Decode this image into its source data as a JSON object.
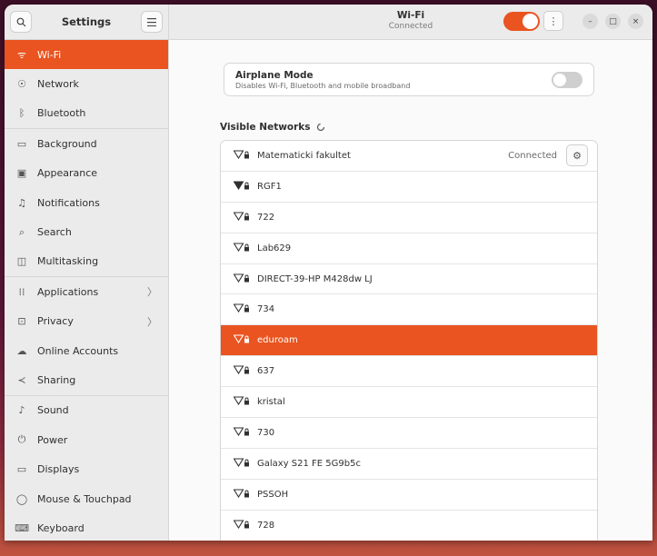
{
  "sidebar": {
    "title": "Settings",
    "search_icon": "search-icon",
    "menu_icon": "hamburger-icon",
    "items": [
      {
        "label": "Wi-Fi",
        "icon": "wifi-icon",
        "glyph": "ᯤ"
      },
      {
        "label": "Network",
        "icon": "network-icon",
        "glyph": "☉"
      },
      {
        "label": "Bluetooth",
        "icon": "bluetooth-icon",
        "glyph": "ᛒ"
      },
      {
        "label": "Background",
        "icon": "background-icon",
        "glyph": "▭"
      },
      {
        "label": "Appearance",
        "icon": "appearance-icon",
        "glyph": "▣"
      },
      {
        "label": "Notifications",
        "icon": "bell-icon",
        "glyph": "♫"
      },
      {
        "label": "Search",
        "icon": "search-icon",
        "glyph": "⌕"
      },
      {
        "label": "Multitasking",
        "icon": "multitasking-icon",
        "glyph": "◫"
      },
      {
        "label": "Applications",
        "icon": "apps-grid-icon",
        "glyph": "⁞⁞"
      },
      {
        "label": "Privacy",
        "icon": "privacy-icon",
        "glyph": "⊡"
      },
      {
        "label": "Online Accounts",
        "icon": "cloud-icon",
        "glyph": "☁"
      },
      {
        "label": "Sharing",
        "icon": "share-icon",
        "glyph": "≺"
      },
      {
        "label": "Sound",
        "icon": "sound-icon",
        "glyph": "♪"
      },
      {
        "label": "Power",
        "icon": "power-icon",
        "glyph": "⏻"
      },
      {
        "label": "Displays",
        "icon": "display-icon",
        "glyph": "▭"
      },
      {
        "label": "Mouse & Touchpad",
        "icon": "mouse-icon",
        "glyph": "◯"
      },
      {
        "label": "Keyboard",
        "icon": "keyboard-icon",
        "glyph": "⌨"
      }
    ]
  },
  "header": {
    "title": "Wi-Fi",
    "subtitle": "Connected",
    "wifi_enabled": true,
    "menu_glyph": "⋮",
    "minimize_glyph": "–",
    "maximize_glyph": "□",
    "close_glyph": "×"
  },
  "airplane": {
    "title": "Airplane Mode",
    "subtitle": "Disables Wi-Fi, Bluetooth and mobile broadband",
    "enabled": false
  },
  "visible_networks": {
    "label": "Visible Networks",
    "refresh_icon": "spinner-icon",
    "connected_text": "Connected",
    "items": [
      {
        "name": "Matematicki fakultet",
        "connected": true
      },
      {
        "name": "RGF1"
      },
      {
        "name": "722"
      },
      {
        "name": "Lab629"
      },
      {
        "name": "DIRECT-39-HP M428dw LJ"
      },
      {
        "name": "734"
      },
      {
        "name": "eduroam",
        "selected": true
      },
      {
        "name": "637"
      },
      {
        "name": "kristal"
      },
      {
        "name": "730"
      },
      {
        "name": "Galaxy S21 FE 5G9b5c"
      },
      {
        "name": "PSSOH"
      },
      {
        "name": "728"
      }
    ]
  },
  "colors": {
    "accent": "#e95420",
    "sidebar_bg": "#ebebeb",
    "content_bg": "#fafafa"
  }
}
